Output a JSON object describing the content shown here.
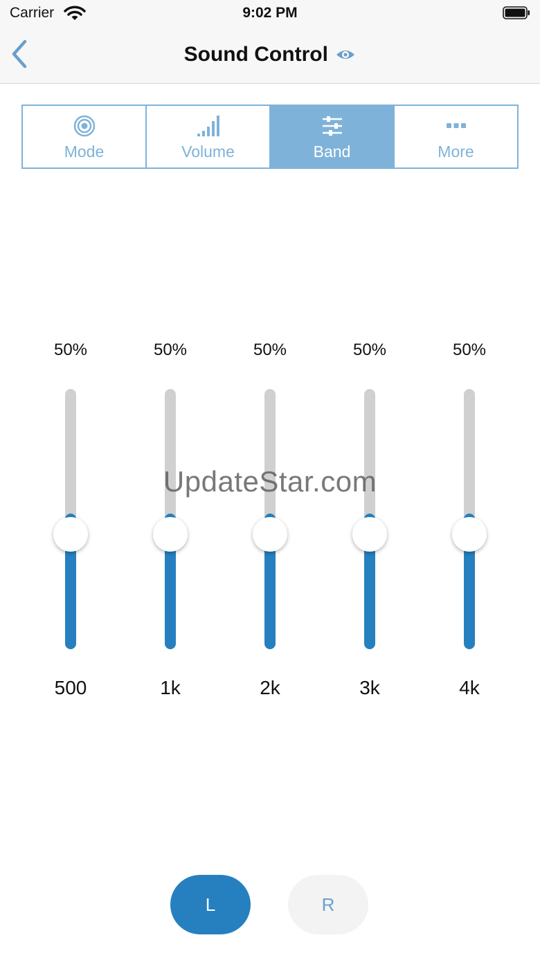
{
  "status_bar": {
    "carrier": "Carrier",
    "time": "9:02 PM"
  },
  "nav": {
    "title": "Sound Control",
    "back_icon": "chevron-left-icon",
    "title_icon": "eye-icon"
  },
  "tabs": [
    {
      "label": "Mode",
      "icon": "target-icon",
      "active": false
    },
    {
      "label": "Volume",
      "icon": "signal-bars-icon",
      "active": false
    },
    {
      "label": "Band",
      "icon": "sliders-icon",
      "active": true
    },
    {
      "label": "More",
      "icon": "more-dots-icon",
      "active": false
    }
  ],
  "bands": [
    {
      "freq": "500",
      "percent_label": "50%",
      "value": 0.5
    },
    {
      "freq": "1k",
      "percent_label": "50%",
      "value": 0.5
    },
    {
      "freq": "2k",
      "percent_label": "50%",
      "value": 0.5
    },
    {
      "freq": "3k",
      "percent_label": "50%",
      "value": 0.5
    },
    {
      "freq": "4k",
      "percent_label": "50%",
      "value": 0.5
    }
  ],
  "watermark": "UpdateStar.com",
  "channels": {
    "left": "L",
    "right": "R",
    "selected": "L"
  },
  "colors": {
    "accent": "#2680bf",
    "tab_accent": "#7fb2d9",
    "track": "#d0d0d0"
  }
}
